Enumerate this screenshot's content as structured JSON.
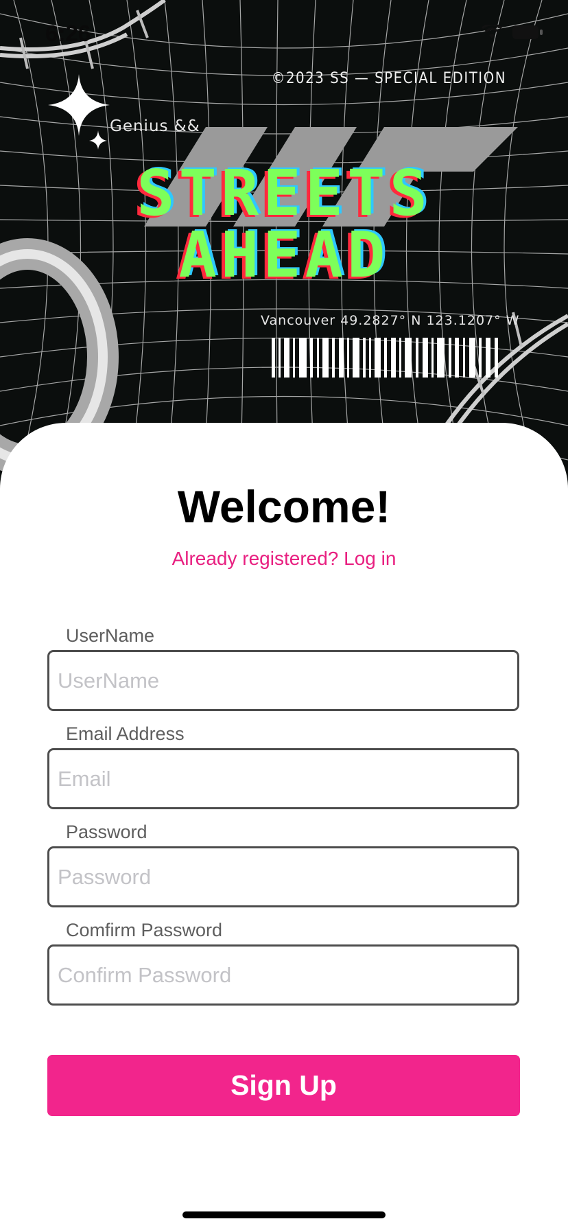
{
  "status_bar": {
    "time": "6:26"
  },
  "banner": {
    "copyright": "©2023 SS — SPECIAL EDITION",
    "tagline": "Genius &&",
    "title_line1": "STREETS",
    "title_line2": "AHEAD",
    "coordinates": "Vancouver 49.2827° N 123.1207° W"
  },
  "form": {
    "heading": "Welcome!",
    "login_link": "Already registered? Log in",
    "fields": [
      {
        "label": "UserName",
        "placeholder": "UserName"
      },
      {
        "label": "Email Address",
        "placeholder": "Email"
      },
      {
        "label": "Password",
        "placeholder": "Password"
      },
      {
        "label": "Comfirm Password",
        "placeholder": "Confirm Password"
      }
    ],
    "submit_label": "Sign Up"
  },
  "colors": {
    "accent": "#f2258c",
    "link": "#e81f80",
    "title_green": "#7dff5a",
    "banner_bg": "#0b0e0d"
  },
  "icons": [
    "wifi-icon",
    "battery-icon",
    "sparkle-icon",
    "barcode-icon"
  ]
}
